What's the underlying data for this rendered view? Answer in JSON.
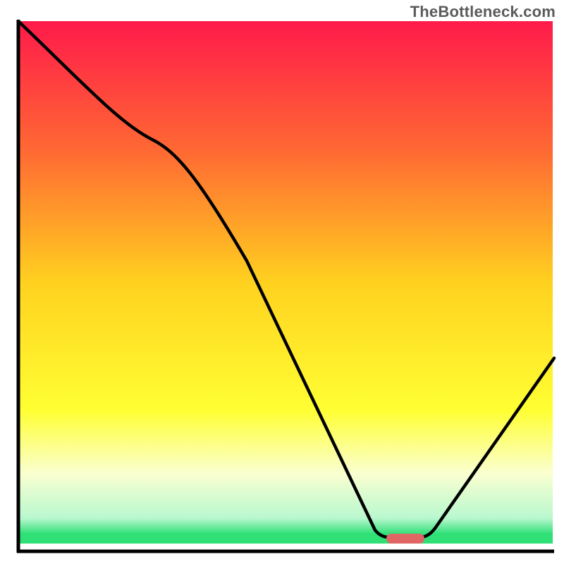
{
  "watermark": "TheBottleneck.com",
  "chart_data": {
    "type": "line",
    "title": "",
    "xlabel": "",
    "ylabel": "",
    "xlim": [
      0,
      100
    ],
    "ylim": [
      0,
      100
    ],
    "x": [
      0,
      25,
      67,
      73,
      100
    ],
    "y": [
      100,
      78,
      2,
      2,
      36
    ],
    "optimum_marker": {
      "x_start": 67,
      "x_end": 73,
      "y": 2
    },
    "background": {
      "type": "vertical_gradient",
      "stops": [
        {
          "pos": 0.0,
          "color": "#ff1a4a"
        },
        {
          "pos": 0.25,
          "color": "#ff6a33"
        },
        {
          "pos": 0.5,
          "color": "#ffd21f"
        },
        {
          "pos": 0.74,
          "color": "#ffff33"
        },
        {
          "pos": 0.86,
          "color": "#faffd0"
        },
        {
          "pos": 0.945,
          "color": "#b9f8cf"
        },
        {
          "pos": 0.975,
          "color": "#2fe077"
        },
        {
          "pos": 1.0,
          "color": "#ffffff"
        }
      ]
    }
  }
}
